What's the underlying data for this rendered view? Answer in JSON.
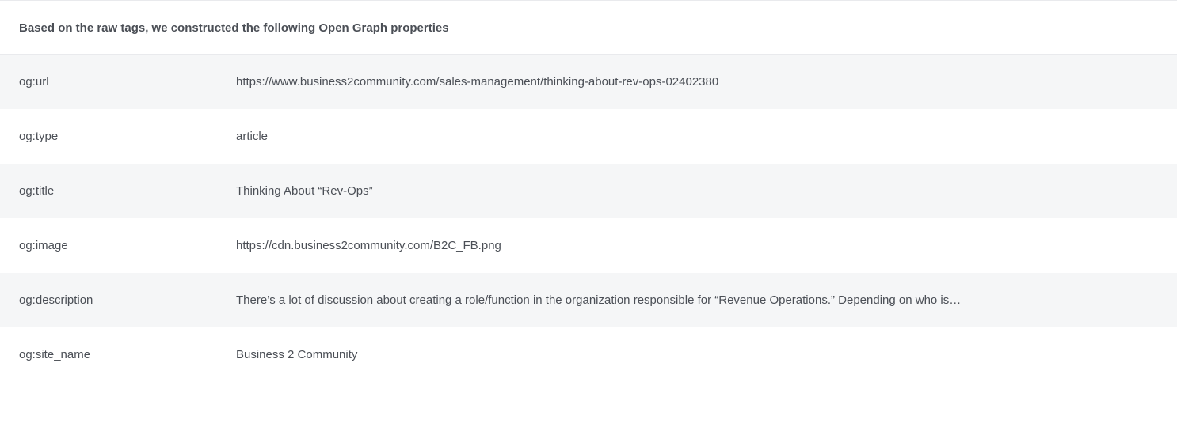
{
  "header": {
    "title": "Based on the raw tags, we constructed the following Open Graph properties"
  },
  "rows": [
    {
      "key": "og:url",
      "value": "https://www.business2community.com/sales-management/thinking-about-rev-ops-02402380"
    },
    {
      "key": "og:type",
      "value": "article"
    },
    {
      "key": "og:title",
      "value": "Thinking About “Rev-Ops”"
    },
    {
      "key": "og:image",
      "value": "https://cdn.business2community.com/B2C_FB.png"
    },
    {
      "key": "og:description",
      "value": "There’s a lot of discussion about creating a role/function in the organization responsible for “Revenue Operations.” Depending on who is…"
    },
    {
      "key": "og:site_name",
      "value": "Business 2 Community"
    }
  ]
}
